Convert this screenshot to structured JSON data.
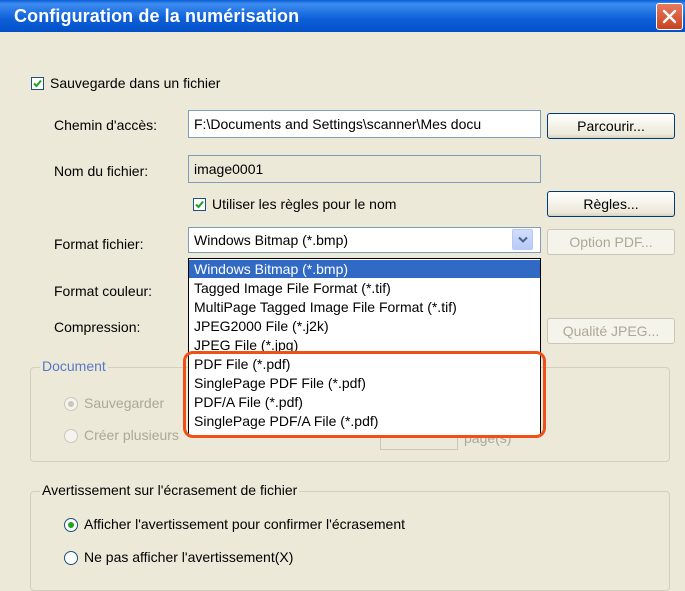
{
  "window": {
    "title": "Configuration de la numérisation"
  },
  "save_to_file": {
    "label": "Sauvegarde dans un fichier",
    "checked": true
  },
  "path": {
    "label": "Chemin d'accès:",
    "value": "F:\\Documents and Settings\\scanner\\Mes docu",
    "browse_label": "Parcourir..."
  },
  "filename": {
    "label": "Nom du fichier:",
    "value": "image0001",
    "use_rules_label": "Utiliser les règles pour le nom",
    "use_rules_checked": true,
    "rules_button": "Règles..."
  },
  "file_format": {
    "label": "Format fichier:",
    "selected": "Windows Bitmap (*.bmp)",
    "pdf_option_button": "Option PDF...",
    "options": [
      "Windows Bitmap (*.bmp)",
      "Tagged Image File Format (*.tif)",
      "MultiPage Tagged Image File Format (*.tif)",
      "JPEG2000 File (*.j2k)",
      "JPEG File (*.jpg)",
      "PDF File (*.pdf)",
      "SinglePage PDF File (*.pdf)",
      "PDF/A File (*.pdf)",
      "SinglePage PDF/A File (*.pdf)"
    ]
  },
  "color_format": {
    "label": "Format couleur:"
  },
  "compression": {
    "label": "Compression:",
    "jpeg_quality_button": "Qualité JPEG..."
  },
  "document_group": {
    "legend": "Document",
    "option1": "Sauvegarder",
    "option2_prefix": "Créer plusieurs",
    "option2_suffix": "page(s)"
  },
  "overwrite_group": {
    "legend": "Avertissement sur l'écrasement de fichier",
    "option1": "Afficher l'avertissement pour confirmer l'écrasement",
    "option2": "Ne pas afficher l'avertissement(X)",
    "selected": 0
  },
  "colors": {
    "title_bar": "#0a5ed6",
    "selection": "#316ac5",
    "highlight_border": "#f05018",
    "dialog_bg": "#ece9d8"
  }
}
